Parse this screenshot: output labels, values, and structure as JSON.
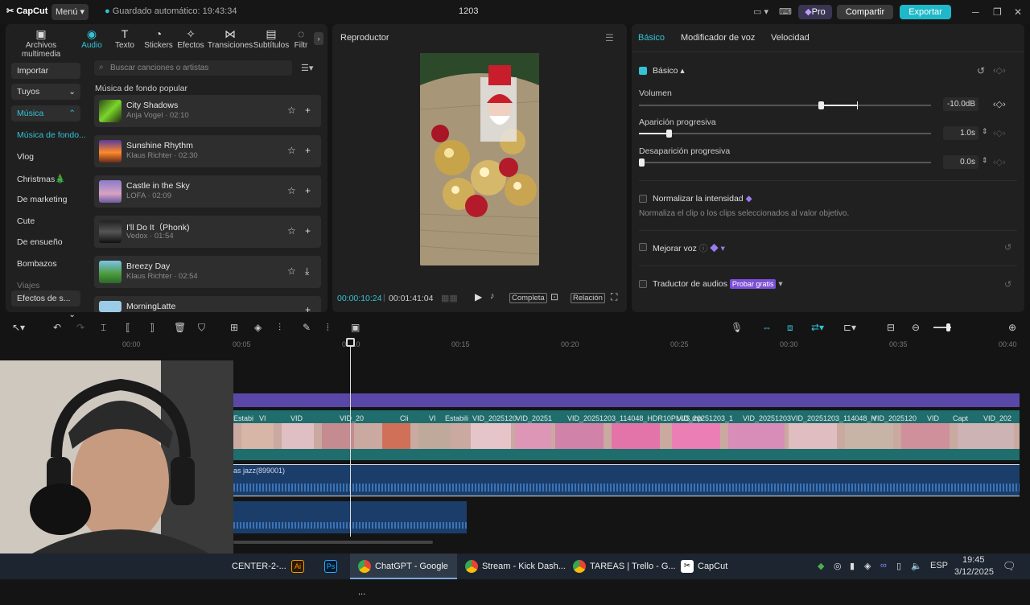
{
  "titlebar": {
    "app_name": "CapCut",
    "menu_label": "Menú",
    "autosave": "Guardado automático: 19:43:34",
    "project_title": "1203",
    "pro_label": "Pro",
    "share_label": "Compartir",
    "export_label": "Exportar"
  },
  "media_tabs": [
    {
      "label": "Archivos multimedia",
      "icon": "media-icon"
    },
    {
      "label": "Audio",
      "icon": "audio-icon",
      "active": true
    },
    {
      "label": "Texto",
      "icon": "text-icon"
    },
    {
      "label": "Stickers",
      "icon": "sticker-icon"
    },
    {
      "label": "Efectos",
      "icon": "effects-icon"
    },
    {
      "label": "Transiciones",
      "icon": "transitions-icon"
    },
    {
      "label": "Subtítulos",
      "icon": "subtitles-icon"
    },
    {
      "label": "Filtr",
      "icon": "filters-icon"
    }
  ],
  "sidebar": {
    "import": "Importar",
    "yours": "Tuyos",
    "music": "Música",
    "items": [
      "Música de fondo...",
      "Vlog",
      "Christmas🎄",
      "De marketing",
      "Cute",
      "De ensueño",
      "Bombazos",
      "Viajes"
    ],
    "effects": "Efectos de s..."
  },
  "search": {
    "placeholder": "Buscar canciones o artistas"
  },
  "music_section_title": "Música de fondo popular",
  "songs": [
    {
      "title": "City Shadows",
      "meta": "Anja Vogel · 02:10"
    },
    {
      "title": "Sunshine Rhythm",
      "meta": "Klaus Richter · 02:30"
    },
    {
      "title": "Castle in the Sky",
      "meta": "LOFA · 02:09"
    },
    {
      "title": "I'll Do It（Phonk)",
      "meta": "Vedox · 01:54"
    },
    {
      "title": "Breezy Day",
      "meta": "Klaus Richter · 02:54"
    },
    {
      "title": "MorningLatte",
      "meta": ""
    }
  ],
  "player": {
    "title": "Reproductor",
    "current_time": "00:00:10:24",
    "total_time": "00:01:41:04",
    "full_label": "Completa",
    "ratio_label": "Relación"
  },
  "properties": {
    "tabs": [
      "Básico",
      "Modificador de voz",
      "Velocidad"
    ],
    "basic_section": "Básico",
    "volume_label": "Volumen",
    "volume_value": "-10.0dB",
    "fade_in_label": "Aparición progresiva",
    "fade_in_value": "1.0s",
    "fade_out_label": "Desaparición progresiva",
    "fade_out_value": "0.0s",
    "normalize_label": "Normalizar la intensidad",
    "normalize_desc": "Normaliza el clip o los clips seleccionados al valor objetivo.",
    "enhance_label": "Mejorar voz",
    "translator_label": "Traductor de audios",
    "try_free": "Probar gratis"
  },
  "timeline": {
    "ruler": [
      "00:00",
      "00:05",
      "00:10",
      "00:15",
      "00:20",
      "00:25",
      "00:30",
      "00:35",
      "00:40"
    ],
    "clips": [
      "Estabi",
      "VI",
      "VID",
      "VID_20",
      "Cli",
      "VI",
      "Estabili",
      "VID_2025120",
      "VID_20251",
      "VID_20251203_114048_HDR10PLUS.mp",
      "VID_20251203_1",
      "VID_20251203",
      "VID_20251203_114048_H",
      "VID_2025120",
      "VID",
      "Capt",
      "VID_202"
    ],
    "audio_label": "as jazz(899001)"
  },
  "taskbar": {
    "items": [
      "CENTER-2-...",
      "",
      "",
      "ChatGPT - Google ...",
      "Stream - Kick Dash...",
      "TAREAS | Trello - G...",
      "CapCut"
    ],
    "lang": "ESP",
    "time": "19:45",
    "date": "3/12/2025"
  },
  "colors": {
    "accent": "#34c3d6",
    "export": "#1fb8c9",
    "video_track": "#1f6d6d",
    "audio_track": "#1b3d6a",
    "purple_track": "#5a48a8"
  }
}
